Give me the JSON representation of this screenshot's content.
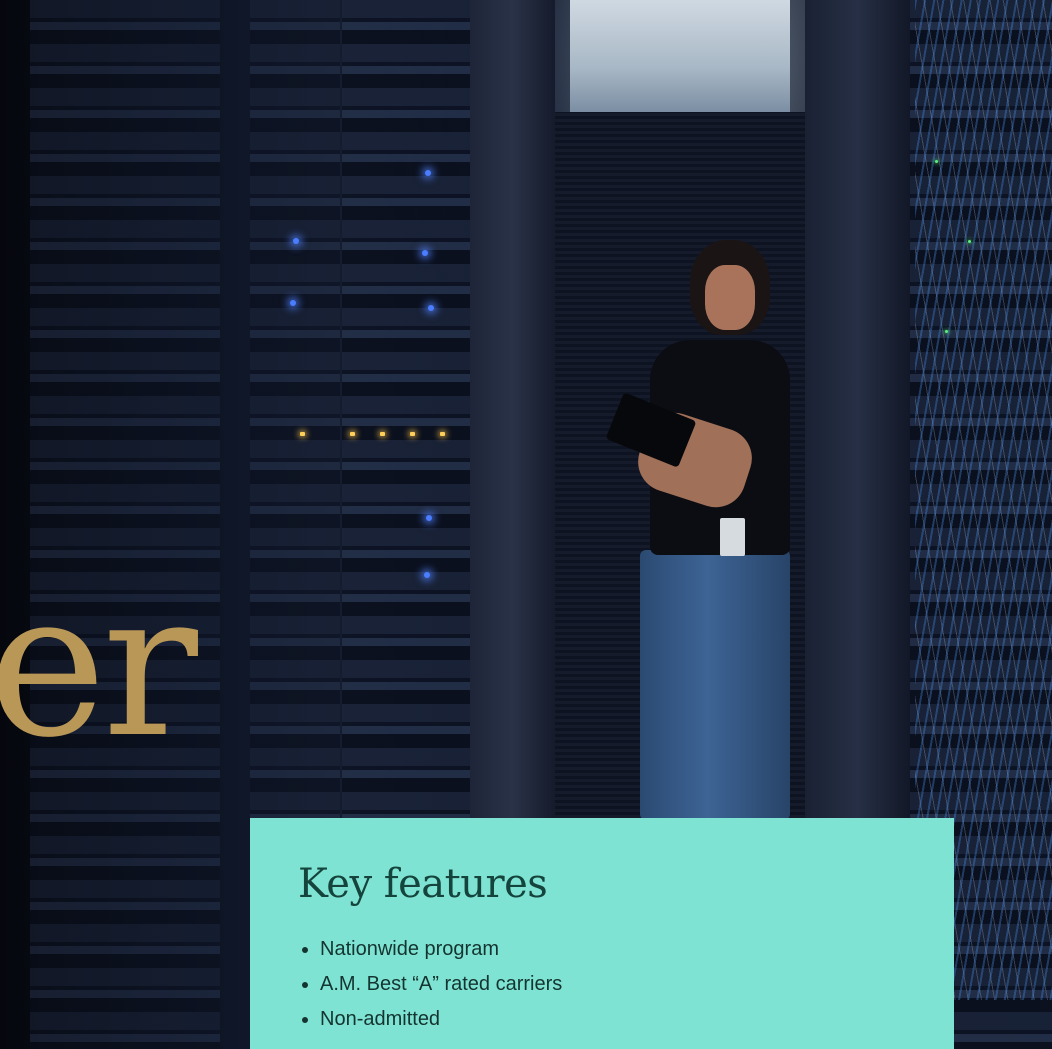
{
  "hero": {
    "brand_fragment": "er"
  },
  "features_card": {
    "title": "Key features",
    "items": [
      {
        "label": "Nationwide program"
      },
      {
        "label": "A.M. Best “A” rated carriers"
      },
      {
        "label": "Non-admitted"
      }
    ]
  },
  "colors": {
    "card_background": "#7fe3d4",
    "card_text": "#14443c",
    "brand_gold": "#b99757",
    "hero_background": "#0b0f1d"
  }
}
